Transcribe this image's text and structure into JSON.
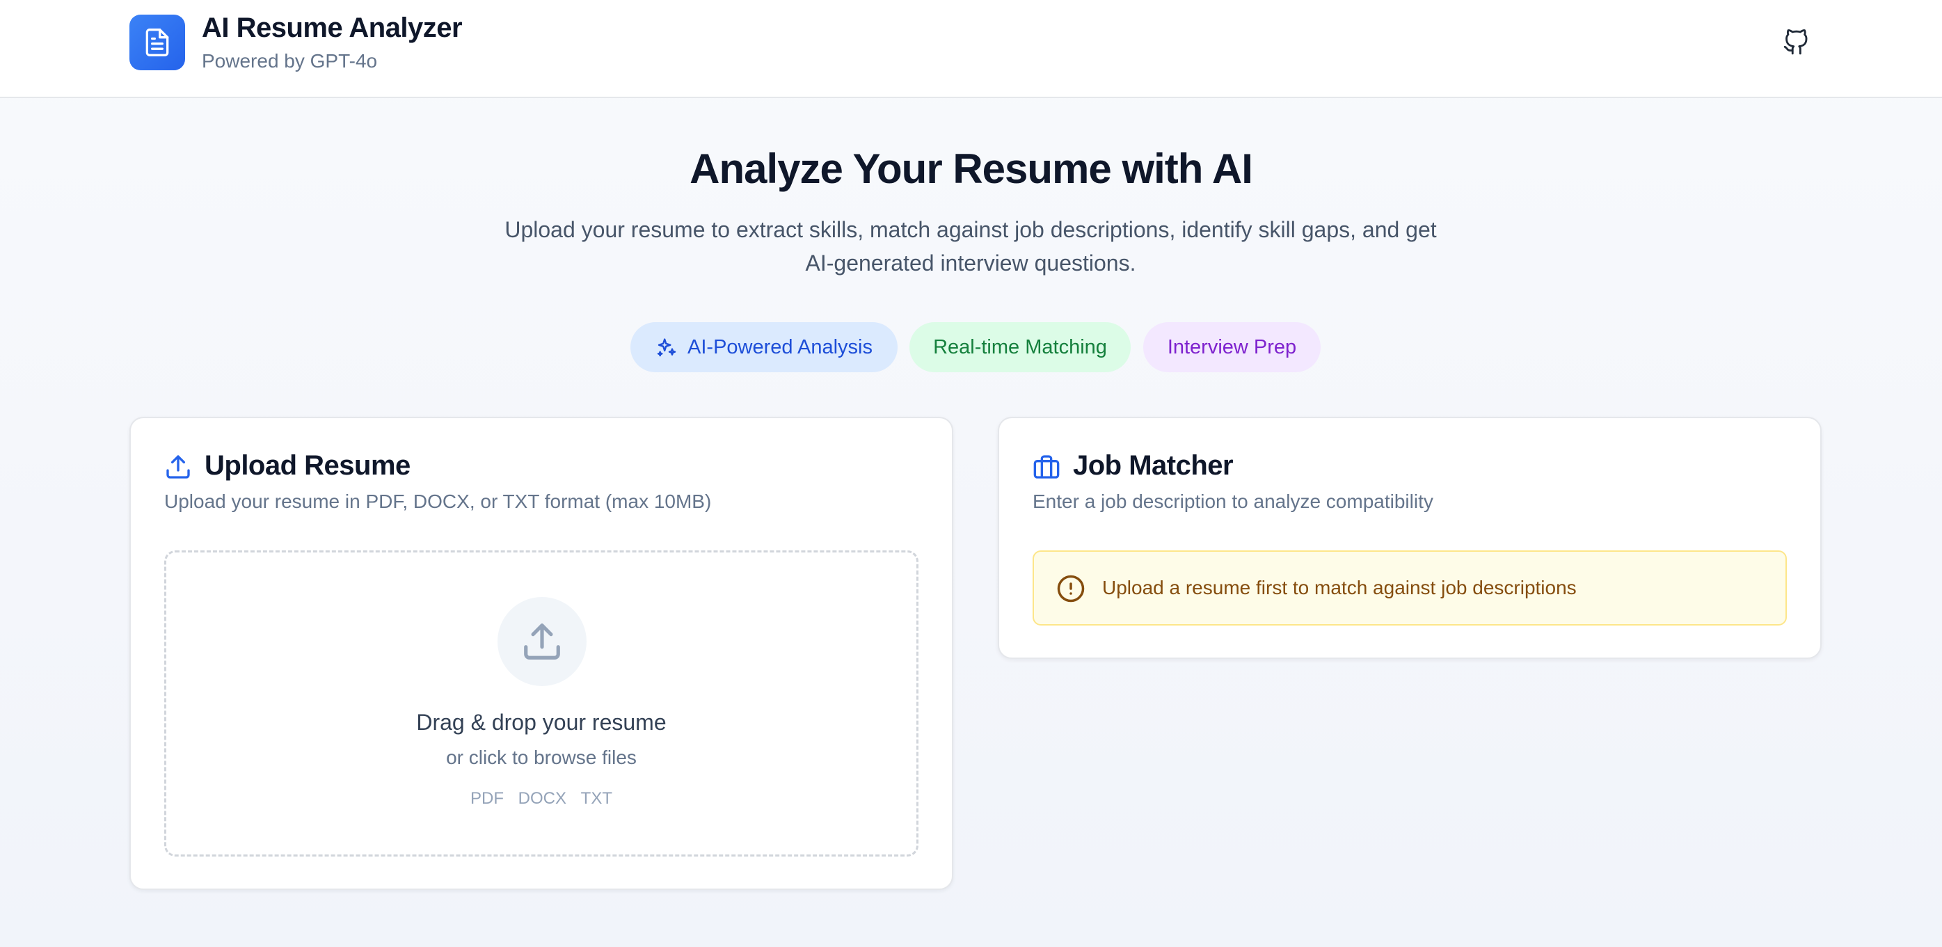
{
  "header": {
    "title": "AI Resume Analyzer",
    "subtitle": "Powered by GPT-4o",
    "logo_icon": "document-icon",
    "github_icon": "github-icon"
  },
  "hero": {
    "title": "Analyze Your Resume with AI",
    "description": "Upload your resume to extract skills, match against job descriptions, identify skill gaps, and get AI-generated interview questions."
  },
  "pills": [
    {
      "label": "AI-Powered Analysis",
      "icon": "sparkles-icon",
      "color": "#1d4ed8",
      "bg": "#dbeafe"
    },
    {
      "label": "Real-time Matching",
      "color": "#15803d",
      "bg": "#dcfce7"
    },
    {
      "label": "Interview Prep",
      "color": "#7e22ce",
      "bg": "#f3e8ff"
    }
  ],
  "upload_card": {
    "title": "Upload Resume",
    "description": "Upload your resume in PDF, DOCX, or TXT format (max 10MB)",
    "icon": "upload-icon",
    "dropzone": {
      "title": "Drag & drop your resume",
      "subtitle": "or click to browse files",
      "formats": [
        "PDF",
        "DOCX",
        "TXT"
      ]
    }
  },
  "job_card": {
    "title": "Job Matcher",
    "description": "Enter a job description to analyze compatibility",
    "icon": "briefcase-icon",
    "alert": {
      "text": "Upload a resume first to match against job descriptions",
      "icon": "alert-circle-icon"
    }
  },
  "colors": {
    "accent": "#2563eb",
    "warning_bg": "#fefce8",
    "warning_text": "#854d0e"
  }
}
